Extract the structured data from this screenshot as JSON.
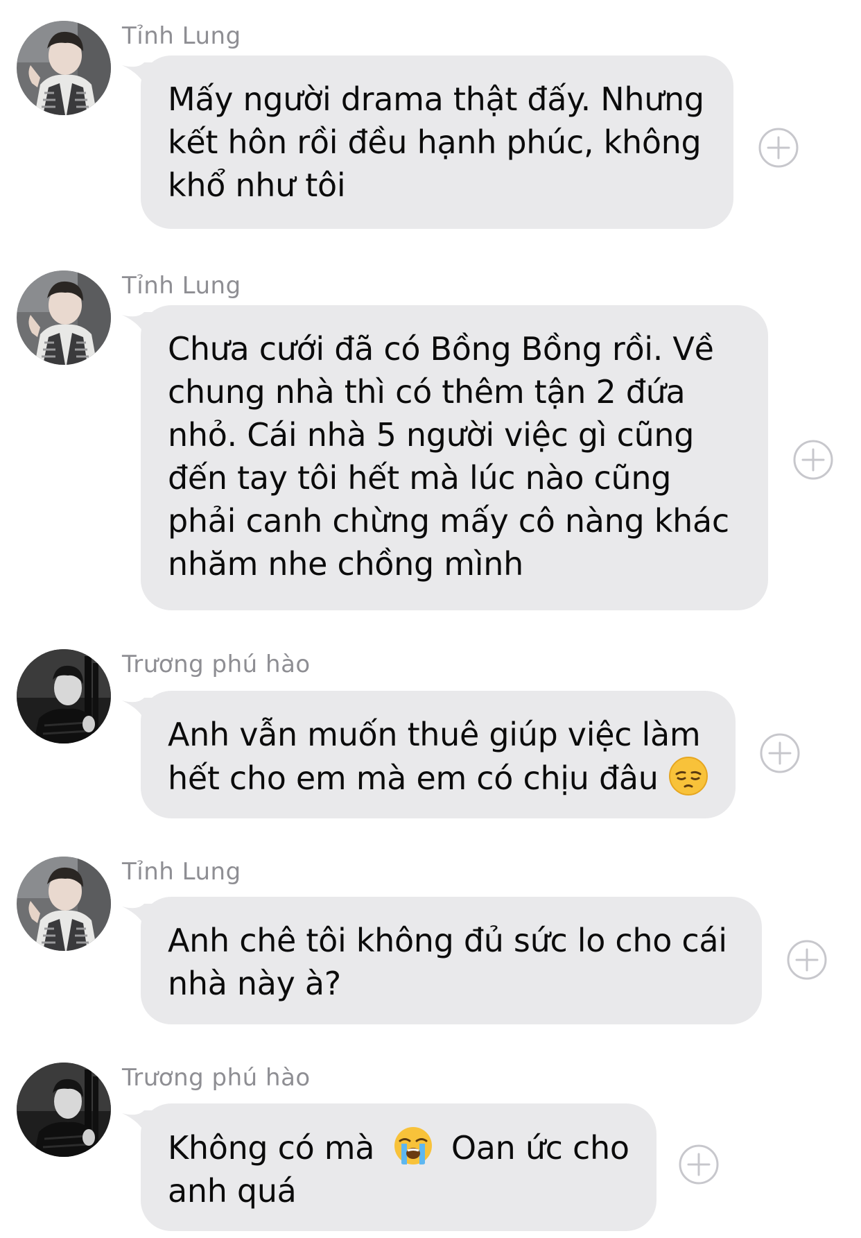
{
  "messages": [
    {
      "sender": "Tỉnh Lung",
      "avatar": "avatar-tinh-lung",
      "text": "Mấy người drama thật đấy. Nhưng kết hôn rồi đều hạnh phúc, không khổ như tôi"
    },
    {
      "sender": "Tỉnh Lung",
      "avatar": "avatar-tinh-lung",
      "text": "Chưa cưới đã có Bồng Bồng rồi. Về chung nhà thì có thêm tận 2 đứa nhỏ. Cái nhà 5 người việc gì cũng đến tay tôi hết mà lúc nào cũng phải canh chừng mấy cô nàng khác nhăm nhe chồng mình"
    },
    {
      "sender": "Trương phú hào",
      "avatar": "avatar-truong-phu-hao",
      "text": "Anh vẫn muốn thuê giúp việc làm hết cho em mà em có chịu đâu",
      "emoji_end": "pensive-face-emoji"
    },
    {
      "sender": "Tỉnh Lung",
      "avatar": "avatar-tinh-lung",
      "text": "Anh chê tôi không đủ sức lo cho cái nhà này à?"
    },
    {
      "sender": "Trương phú hào",
      "avatar": "avatar-truong-phu-hao",
      "text_before": "Không có mà",
      "emoji_mid": "loudly-crying-face-emoji",
      "text_after": "Oan ức cho anh quá"
    }
  ],
  "colors": {
    "bubble": "#e9e9eb",
    "sender": "#8e8e93",
    "text": "#0b0b0b",
    "plus_icon": "#c7c7cc"
  }
}
